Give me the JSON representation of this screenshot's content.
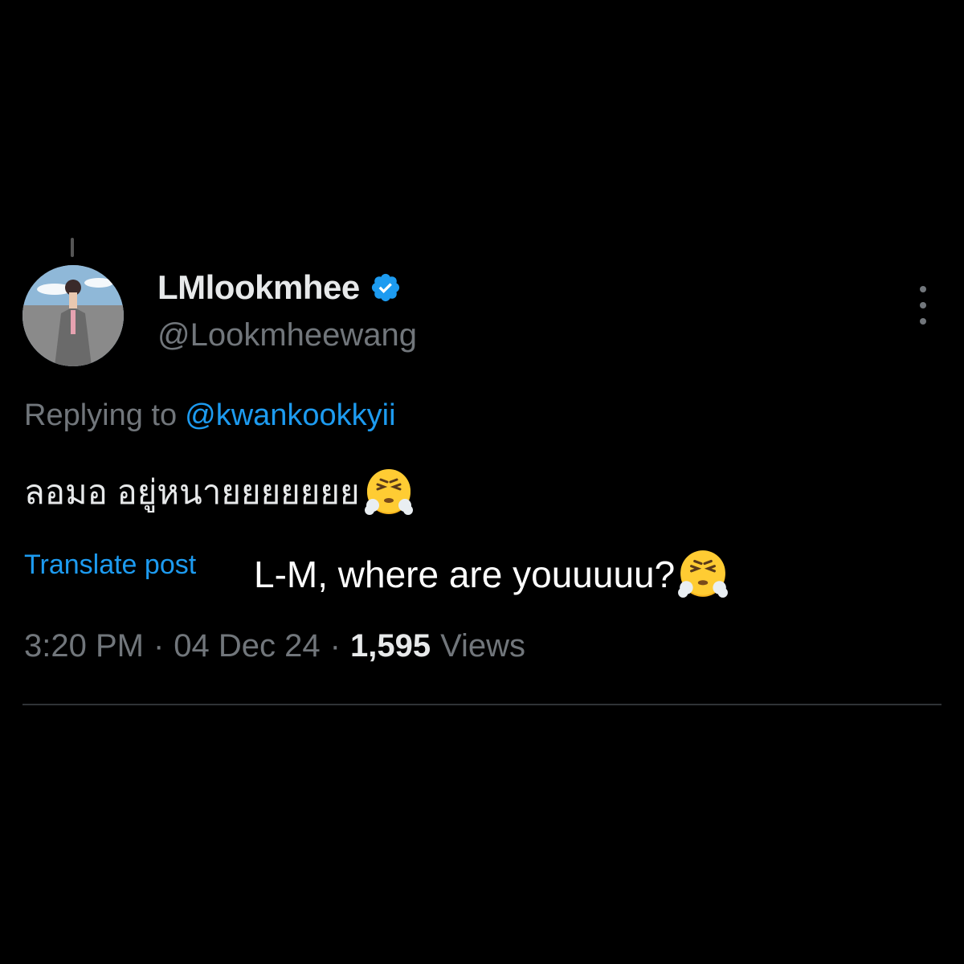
{
  "author": {
    "display_name": "LMlookmhee",
    "handle": "@Lookmheewang",
    "verified": true
  },
  "reply": {
    "prefix": "Replying to",
    "mention": "@kwankookkyii"
  },
  "post": {
    "text": "ลอมอ อยู่หนายยยยยยย",
    "emoji": "face-with-steam-from-nose"
  },
  "translate_label": "Translate post",
  "overlay_caption": {
    "text": "L-M, where are youuuuu?",
    "emoji": "face-with-steam-from-nose"
  },
  "meta": {
    "time": "3:20 PM",
    "date": "04 Dec 24",
    "views_count": "1,595",
    "views_label": "Views",
    "separator": "·"
  },
  "colors": {
    "background": "#000000",
    "primary_text": "#e7e9ea",
    "secondary_text": "#71767b",
    "accent": "#1d9bf0",
    "divider": "#2f3336"
  },
  "icons": {
    "verified": "verified-badge-icon",
    "more": "more-options-icon"
  }
}
